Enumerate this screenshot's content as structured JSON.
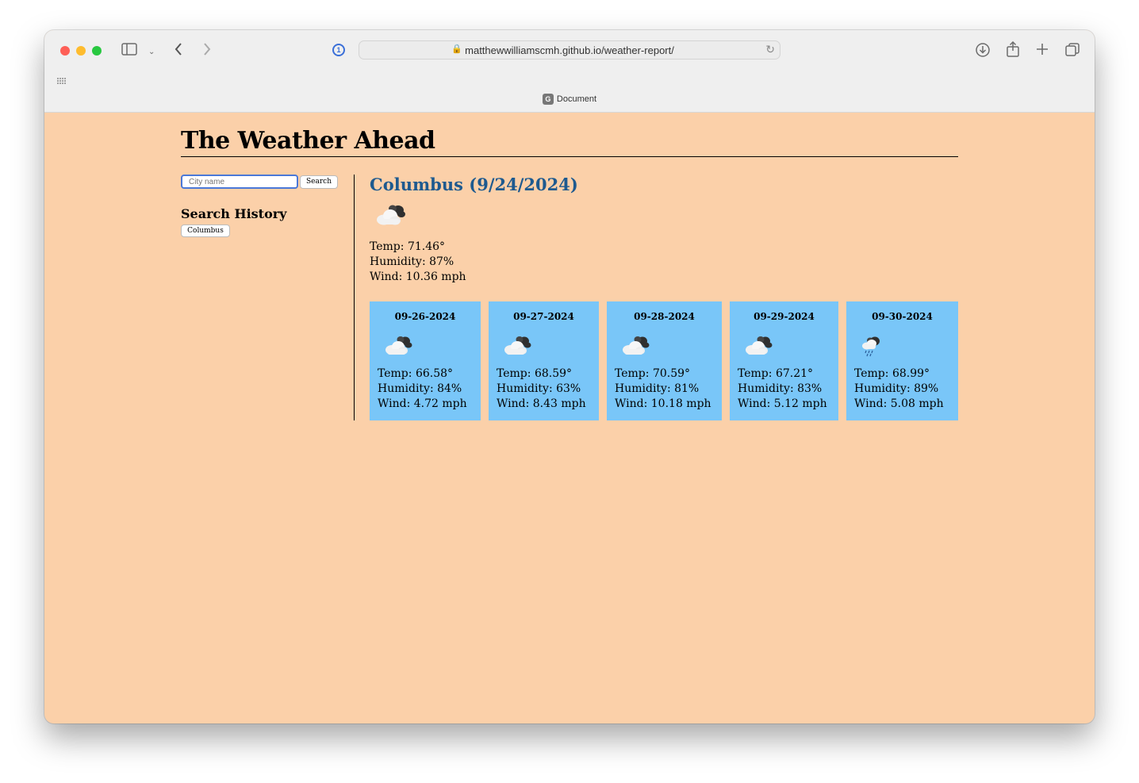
{
  "browser": {
    "url": "matthewwilliamscmh.github.io/weather-report/",
    "tab_title": "Document",
    "tab_favicon_letter": "G"
  },
  "app": {
    "title": "The Weather Ahead",
    "search": {
      "placeholder": "City name",
      "button": "Search"
    },
    "history": {
      "title": "Search History",
      "items": [
        "Columbus"
      ]
    },
    "current": {
      "heading": "Columbus (9/24/2024)",
      "icon": "partly-cloudy-icon",
      "temp": "Temp: 71.46°",
      "humidity": "Humidity: 87%",
      "wind": "Wind: 10.36 mph"
    },
    "forecast": [
      {
        "date": "09-26-2024",
        "icon": "partly-cloudy-icon",
        "temp": "Temp: 66.58°",
        "humidity": "Humidity: 84%",
        "wind": "Wind: 4.72 mph"
      },
      {
        "date": "09-27-2024",
        "icon": "partly-cloudy-icon",
        "temp": "Temp: 68.59°",
        "humidity": "Humidity: 63%",
        "wind": "Wind: 8.43 mph"
      },
      {
        "date": "09-28-2024",
        "icon": "partly-cloudy-icon",
        "temp": "Temp: 70.59°",
        "humidity": "Humidity: 81%",
        "wind": "Wind: 10.18 mph"
      },
      {
        "date": "09-29-2024",
        "icon": "partly-cloudy-icon",
        "temp": "Temp: 67.21°",
        "humidity": "Humidity: 83%",
        "wind": "Wind: 5.12 mph"
      },
      {
        "date": "09-30-2024",
        "icon": "rain-cloud-icon",
        "temp": "Temp: 68.99°",
        "humidity": "Humidity: 89%",
        "wind": "Wind: 5.08 mph"
      }
    ]
  },
  "colors": {
    "page_bg": "#fbd0a9",
    "card_bg": "#79c6f8",
    "heading": "#1e5a8f"
  }
}
